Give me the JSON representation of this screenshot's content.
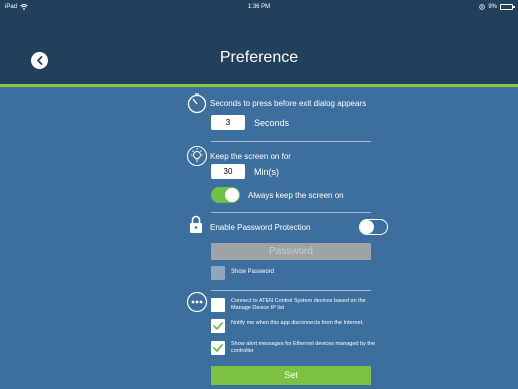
{
  "status_bar": {
    "device": "iPad",
    "time": "1:36 PM",
    "battery": "9%"
  },
  "header": {
    "title": "Preference",
    "back_icon": "chevron-left-icon"
  },
  "colors": {
    "header_bg": "#22405c",
    "body_bg": "#3d6f9e",
    "accent": "#8cc63f",
    "toggle_on": "#6cc24a",
    "set_button": "#7dc142"
  },
  "exit_dialog": {
    "label": "Seconds to press before exit dialog appears",
    "value": "3",
    "unit": "Seconds"
  },
  "screen_on": {
    "label": "Keep the screen on for",
    "value": "30",
    "unit": "Min(s)",
    "always_on_label": "Always keep the screen on",
    "always_on": true
  },
  "password": {
    "label": "Enable Password Protection",
    "enabled": false,
    "placeholder": "Password",
    "show_label": "Show Password",
    "show_checked": false
  },
  "options": {
    "items": [
      {
        "label": "Connect to ATEN Control System devices based on the Manage Device IP list",
        "checked": false
      },
      {
        "label": "Notify me when this app disconnects from the Internet.",
        "checked": true
      },
      {
        "label": "Show alert messages for Ethernet devices managed by the controller",
        "checked": true
      }
    ]
  },
  "set_label": "Set"
}
